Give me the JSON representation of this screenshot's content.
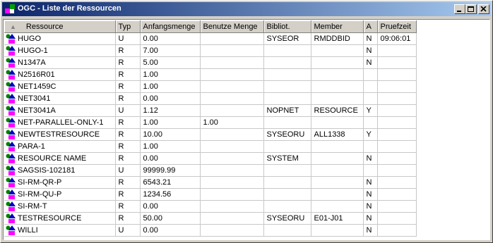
{
  "window": {
    "title": "OGC - Liste der Ressourcen"
  },
  "columns": {
    "ressource": "Ressource",
    "typ": "Typ",
    "anfangsmenge": "Anfangsmenge",
    "benutze_menge": "Benutze Menge",
    "bibliot": "Bibliot.",
    "member": "Member",
    "a": "A",
    "pruefzeit": "Pruefzeit"
  },
  "rows": [
    {
      "ressource": "HUGO",
      "typ": "U",
      "anfangsmenge": "0.00",
      "benutze_menge": "",
      "bibliot": "SYSEOR",
      "member": "RMDDBID",
      "a": "N",
      "pruefzeit": "09:06:01"
    },
    {
      "ressource": "HUGO-1",
      "typ": "R",
      "anfangsmenge": "7.00",
      "benutze_menge": "",
      "bibliot": "",
      "member": "",
      "a": "N",
      "pruefzeit": ""
    },
    {
      "ressource": "N1347A",
      "typ": "R",
      "anfangsmenge": "5.00",
      "benutze_menge": "",
      "bibliot": "",
      "member": "",
      "a": "N",
      "pruefzeit": ""
    },
    {
      "ressource": "N2516R01",
      "typ": "R",
      "anfangsmenge": "1.00",
      "benutze_menge": "",
      "bibliot": "",
      "member": "",
      "a": "",
      "pruefzeit": ""
    },
    {
      "ressource": "NET1459C",
      "typ": "R",
      "anfangsmenge": "1.00",
      "benutze_menge": "",
      "bibliot": "",
      "member": "",
      "a": "",
      "pruefzeit": ""
    },
    {
      "ressource": "NET3041",
      "typ": "R",
      "anfangsmenge": "0.00",
      "benutze_menge": "",
      "bibliot": "",
      "member": "",
      "a": "",
      "pruefzeit": ""
    },
    {
      "ressource": "NET3041A",
      "typ": "U",
      "anfangsmenge": "1.12",
      "benutze_menge": "",
      "bibliot": "NOPNET",
      "member": "RESOURCE",
      "a": "Y",
      "pruefzeit": ""
    },
    {
      "ressource": "NET-PARALLEL-ONLY-1",
      "typ": "R",
      "anfangsmenge": "1.00",
      "benutze_menge": "1.00",
      "bibliot": "",
      "member": "",
      "a": "",
      "pruefzeit": ""
    },
    {
      "ressource": "NEWTESTRESOURCE",
      "typ": "R",
      "anfangsmenge": "10.00",
      "benutze_menge": "",
      "bibliot": "SYSEORU",
      "member": "ALL1338",
      "a": "Y",
      "pruefzeit": ""
    },
    {
      "ressource": "PARA-1",
      "typ": "R",
      "anfangsmenge": "1.00",
      "benutze_menge": "",
      "bibliot": "",
      "member": "",
      "a": "",
      "pruefzeit": ""
    },
    {
      "ressource": "RESOURCE NAME",
      "typ": "R",
      "anfangsmenge": "0.00",
      "benutze_menge": "",
      "bibliot": "SYSTEM",
      "member": "",
      "a": "N",
      "pruefzeit": ""
    },
    {
      "ressource": "SAGSIS-102181",
      "typ": "U",
      "anfangsmenge": "99999.99",
      "benutze_menge": "",
      "bibliot": "",
      "member": "",
      "a": "",
      "pruefzeit": ""
    },
    {
      "ressource": "SI-RM-QR-P",
      "typ": "R",
      "anfangsmenge": "6543.21",
      "benutze_menge": "",
      "bibliot": "",
      "member": "",
      "a": "N",
      "pruefzeit": ""
    },
    {
      "ressource": "SI-RM-QU-P",
      "typ": "R",
      "anfangsmenge": "1234.56",
      "benutze_menge": "",
      "bibliot": "",
      "member": "",
      "a": "N",
      "pruefzeit": ""
    },
    {
      "ressource": "SI-RM-T",
      "typ": "R",
      "anfangsmenge": "0.00",
      "benutze_menge": "",
      "bibliot": "",
      "member": "",
      "a": "N",
      "pruefzeit": ""
    },
    {
      "ressource": "TESTRESOURCE",
      "typ": "R",
      "anfangsmenge": "50.00",
      "benutze_menge": "",
      "bibliot": "SYSEORU",
      "member": "E01-J01",
      "a": "N",
      "pruefzeit": ""
    },
    {
      "ressource": "WILLI",
      "typ": "U",
      "anfangsmenge": "0.00",
      "benutze_menge": "",
      "bibliot": "",
      "member": "",
      "a": "N",
      "pruefzeit": ""
    }
  ],
  "icons": {
    "row_icon": "resource-icon",
    "sort": "sort-ascending-icon"
  },
  "colors": {
    "titlebar_start": "#0a246a",
    "titlebar_end": "#a6caf0"
  }
}
